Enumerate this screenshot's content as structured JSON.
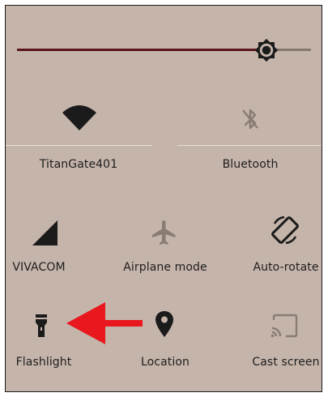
{
  "brightness": {
    "level": 0.87
  },
  "tiles": {
    "wifi": {
      "label": "TitanGate401",
      "icon": "wifi-icon"
    },
    "bluetooth": {
      "label": "Bluetooth",
      "icon": "bluetooth-off-icon"
    },
    "cellular": {
      "label": "VIVACOM",
      "icon": "cell-signal-icon"
    },
    "airplane": {
      "label": "Airplane mode",
      "icon": "airplane-icon"
    },
    "rotate": {
      "label": "Auto-rotate",
      "icon": "rotate-icon"
    },
    "flashlight": {
      "label": "Flashlight",
      "icon": "flashlight-icon"
    },
    "location": {
      "label": "Location",
      "icon": "location-pin-icon"
    },
    "cast": {
      "label": "Cast screen",
      "icon": "cast-icon"
    }
  },
  "colors": {
    "panel": "#c5b4aa",
    "slider_fill": "#5a1719",
    "arrow": "#e8181e",
    "icon_active": "#1b1b1b",
    "icon_inactive": "#8a7c74"
  }
}
